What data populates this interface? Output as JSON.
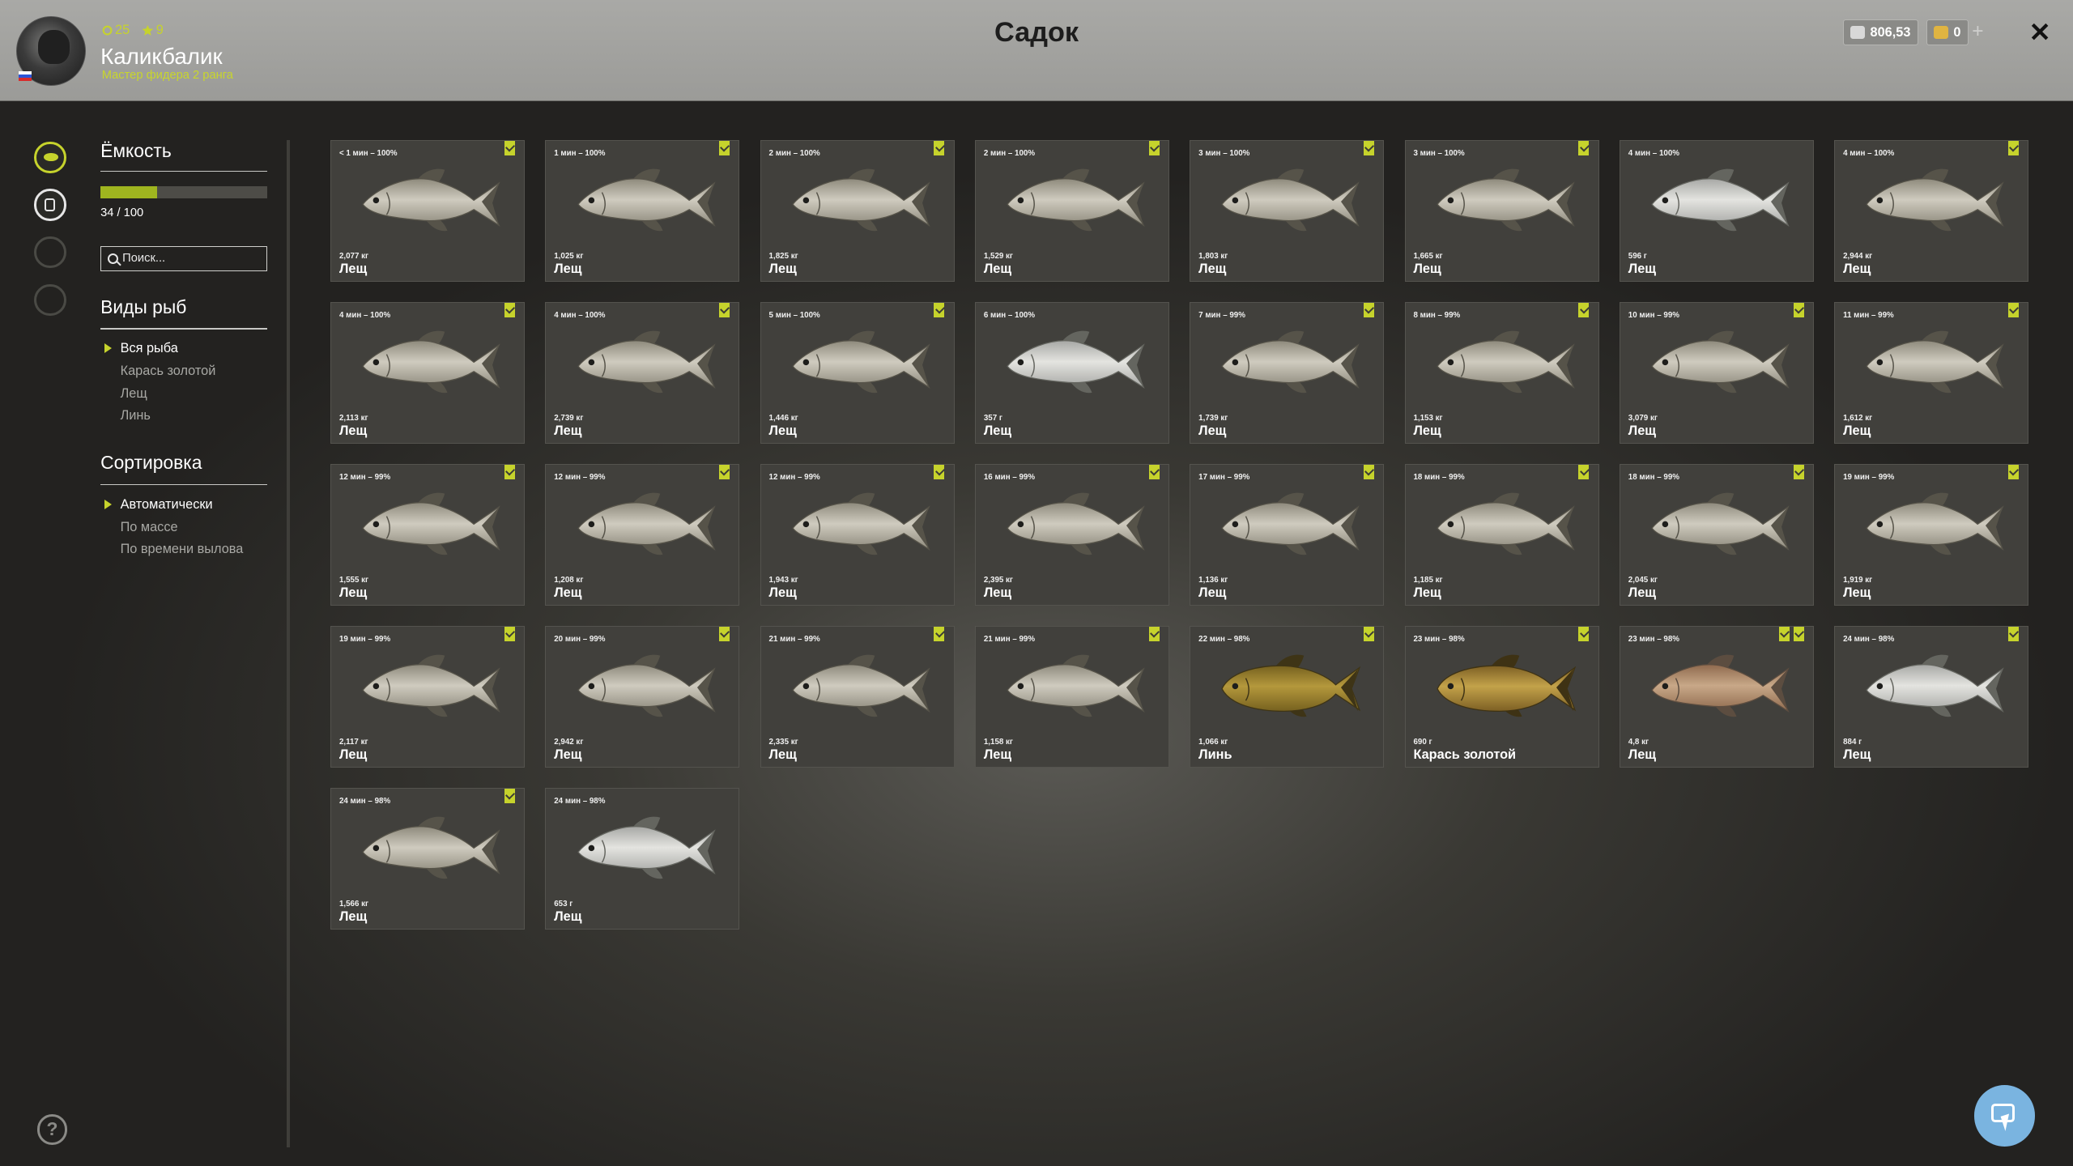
{
  "header": {
    "title": "Садок",
    "player": {
      "level": "25",
      "stars": "9",
      "name": "Каликбалик",
      "rank": "Мастер фидера 2 ранга"
    },
    "currency": {
      "silver": "806,53",
      "gold": "0",
      "silver_color": "#d8d8d8",
      "gold_color": "#e0b441"
    }
  },
  "sidebar": {
    "capacity": {
      "title": "Ёмкость",
      "current": 34,
      "max": 100,
      "text": "34 / 100"
    },
    "search": {
      "placeholder": "Поиск..."
    },
    "species": {
      "title": "Виды рыб",
      "items": [
        "Вся рыба",
        "Карась золотой",
        "Лещ",
        "Линь"
      ],
      "selected": 0
    },
    "sort": {
      "title": "Сортировка",
      "items": [
        "Автоматически",
        "По массе",
        "По времени вылова"
      ],
      "selected": 0
    }
  },
  "colors": {
    "accent": "#c6d32c"
  },
  "fish": [
    {
      "time": "< 1 мин – 100%",
      "weight": "2,077 кг",
      "name": "Лещ",
      "bookmarks": 1,
      "type": "bream"
    },
    {
      "time": "1 мин – 100%",
      "weight": "1,025 кг",
      "name": "Лещ",
      "bookmarks": 1,
      "type": "bream"
    },
    {
      "time": "2 мин – 100%",
      "weight": "1,825 кг",
      "name": "Лещ",
      "bookmarks": 1,
      "type": "bream"
    },
    {
      "time": "2 мин – 100%",
      "weight": "1,529 кг",
      "name": "Лещ",
      "bookmarks": 1,
      "type": "bream"
    },
    {
      "time": "3 мин – 100%",
      "weight": "1,803 кг",
      "name": "Лещ",
      "bookmarks": 1,
      "type": "bream"
    },
    {
      "time": "3 мин – 100%",
      "weight": "1,665 кг",
      "name": "Лещ",
      "bookmarks": 1,
      "type": "bream"
    },
    {
      "time": "4 мин – 100%",
      "weight": "596 г",
      "name": "Лещ",
      "bookmarks": 0,
      "type": "silver"
    },
    {
      "time": "4 мин – 100%",
      "weight": "2,944 кг",
      "name": "Лещ",
      "bookmarks": 1,
      "type": "bream"
    },
    {
      "time": "4 мин – 100%",
      "weight": "2,113 кг",
      "name": "Лещ",
      "bookmarks": 1,
      "type": "bream"
    },
    {
      "time": "4 мин – 100%",
      "weight": "2,739 кг",
      "name": "Лещ",
      "bookmarks": 1,
      "type": "bream"
    },
    {
      "time": "5 мин – 100%",
      "weight": "1,446 кг",
      "name": "Лещ",
      "bookmarks": 1,
      "type": "bream"
    },
    {
      "time": "6 мин – 100%",
      "weight": "357 г",
      "name": "Лещ",
      "bookmarks": 0,
      "type": "silver"
    },
    {
      "time": "7 мин – 99%",
      "weight": "1,739 кг",
      "name": "Лещ",
      "bookmarks": 1,
      "type": "bream"
    },
    {
      "time": "8 мин – 99%",
      "weight": "1,153 кг",
      "name": "Лещ",
      "bookmarks": 1,
      "type": "bream"
    },
    {
      "time": "10 мин – 99%",
      "weight": "3,079 кг",
      "name": "Лещ",
      "bookmarks": 1,
      "type": "bream"
    },
    {
      "time": "11 мин – 99%",
      "weight": "1,612 кг",
      "name": "Лещ",
      "bookmarks": 1,
      "type": "bream"
    },
    {
      "time": "12 мин – 99%",
      "weight": "1,555 кг",
      "name": "Лещ",
      "bookmarks": 1,
      "type": "bream"
    },
    {
      "time": "12 мин – 99%",
      "weight": "1,208 кг",
      "name": "Лещ",
      "bookmarks": 1,
      "type": "bream"
    },
    {
      "time": "12 мин – 99%",
      "weight": "1,943 кг",
      "name": "Лещ",
      "bookmarks": 1,
      "type": "bream"
    },
    {
      "time": "16 мин – 99%",
      "weight": "2,395 кг",
      "name": "Лещ",
      "bookmarks": 1,
      "type": "bream"
    },
    {
      "time": "17 мин – 99%",
      "weight": "1,136 кг",
      "name": "Лещ",
      "bookmarks": 1,
      "type": "bream"
    },
    {
      "time": "18 мин – 99%",
      "weight": "1,185 кг",
      "name": "Лещ",
      "bookmarks": 1,
      "type": "bream"
    },
    {
      "time": "18 мин – 99%",
      "weight": "2,045 кг",
      "name": "Лещ",
      "bookmarks": 1,
      "type": "bream"
    },
    {
      "time": "19 мин – 99%",
      "weight": "1,919 кг",
      "name": "Лещ",
      "bookmarks": 1,
      "type": "bream"
    },
    {
      "time": "19 мин – 99%",
      "weight": "2,117 кг",
      "name": "Лещ",
      "bookmarks": 1,
      "type": "bream"
    },
    {
      "time": "20 мин – 99%",
      "weight": "2,942 кг",
      "name": "Лещ",
      "bookmarks": 1,
      "type": "bream"
    },
    {
      "time": "21 мин – 99%",
      "weight": "2,335 кг",
      "name": "Лещ",
      "bookmarks": 1,
      "type": "bream"
    },
    {
      "time": "21 мин – 99%",
      "weight": "1,158 кг",
      "name": "Лещ",
      "bookmarks": 1,
      "type": "bream"
    },
    {
      "time": "22 мин – 98%",
      "weight": "1,066 кг",
      "name": "Линь",
      "bookmarks": 1,
      "type": "tench"
    },
    {
      "time": "23 мин – 98%",
      "weight": "690 г",
      "name": "Карась золотой",
      "bookmarks": 1,
      "type": "carp"
    },
    {
      "time": "23 мин – 98%",
      "weight": "4,8 кг",
      "name": "Лещ",
      "bookmarks": 2,
      "type": "bronze"
    },
    {
      "time": "24 мин – 98%",
      "weight": "884 г",
      "name": "Лещ",
      "bookmarks": 1,
      "type": "silver"
    },
    {
      "time": "24 мин – 98%",
      "weight": "1,566 кг",
      "name": "Лещ",
      "bookmarks": 1,
      "type": "bream"
    },
    {
      "time": "24 мин – 98%",
      "weight": "653 г",
      "name": "Лещ",
      "bookmarks": 0,
      "type": "silver"
    }
  ],
  "fish_colors": {
    "bream": [
      "#cfcbbf",
      "#8e8a7c",
      "#565349"
    ],
    "silver": [
      "#e4e4e0",
      "#a7a8a5",
      "#64655f"
    ],
    "tench": [
      "#b4983c",
      "#76611f",
      "#3e3416"
    ],
    "carp": [
      "#c3a24a",
      "#7d6024",
      "#3e3214"
    ],
    "bronze": [
      "#c8a888",
      "#8f6a4e",
      "#5c4d40"
    ]
  }
}
